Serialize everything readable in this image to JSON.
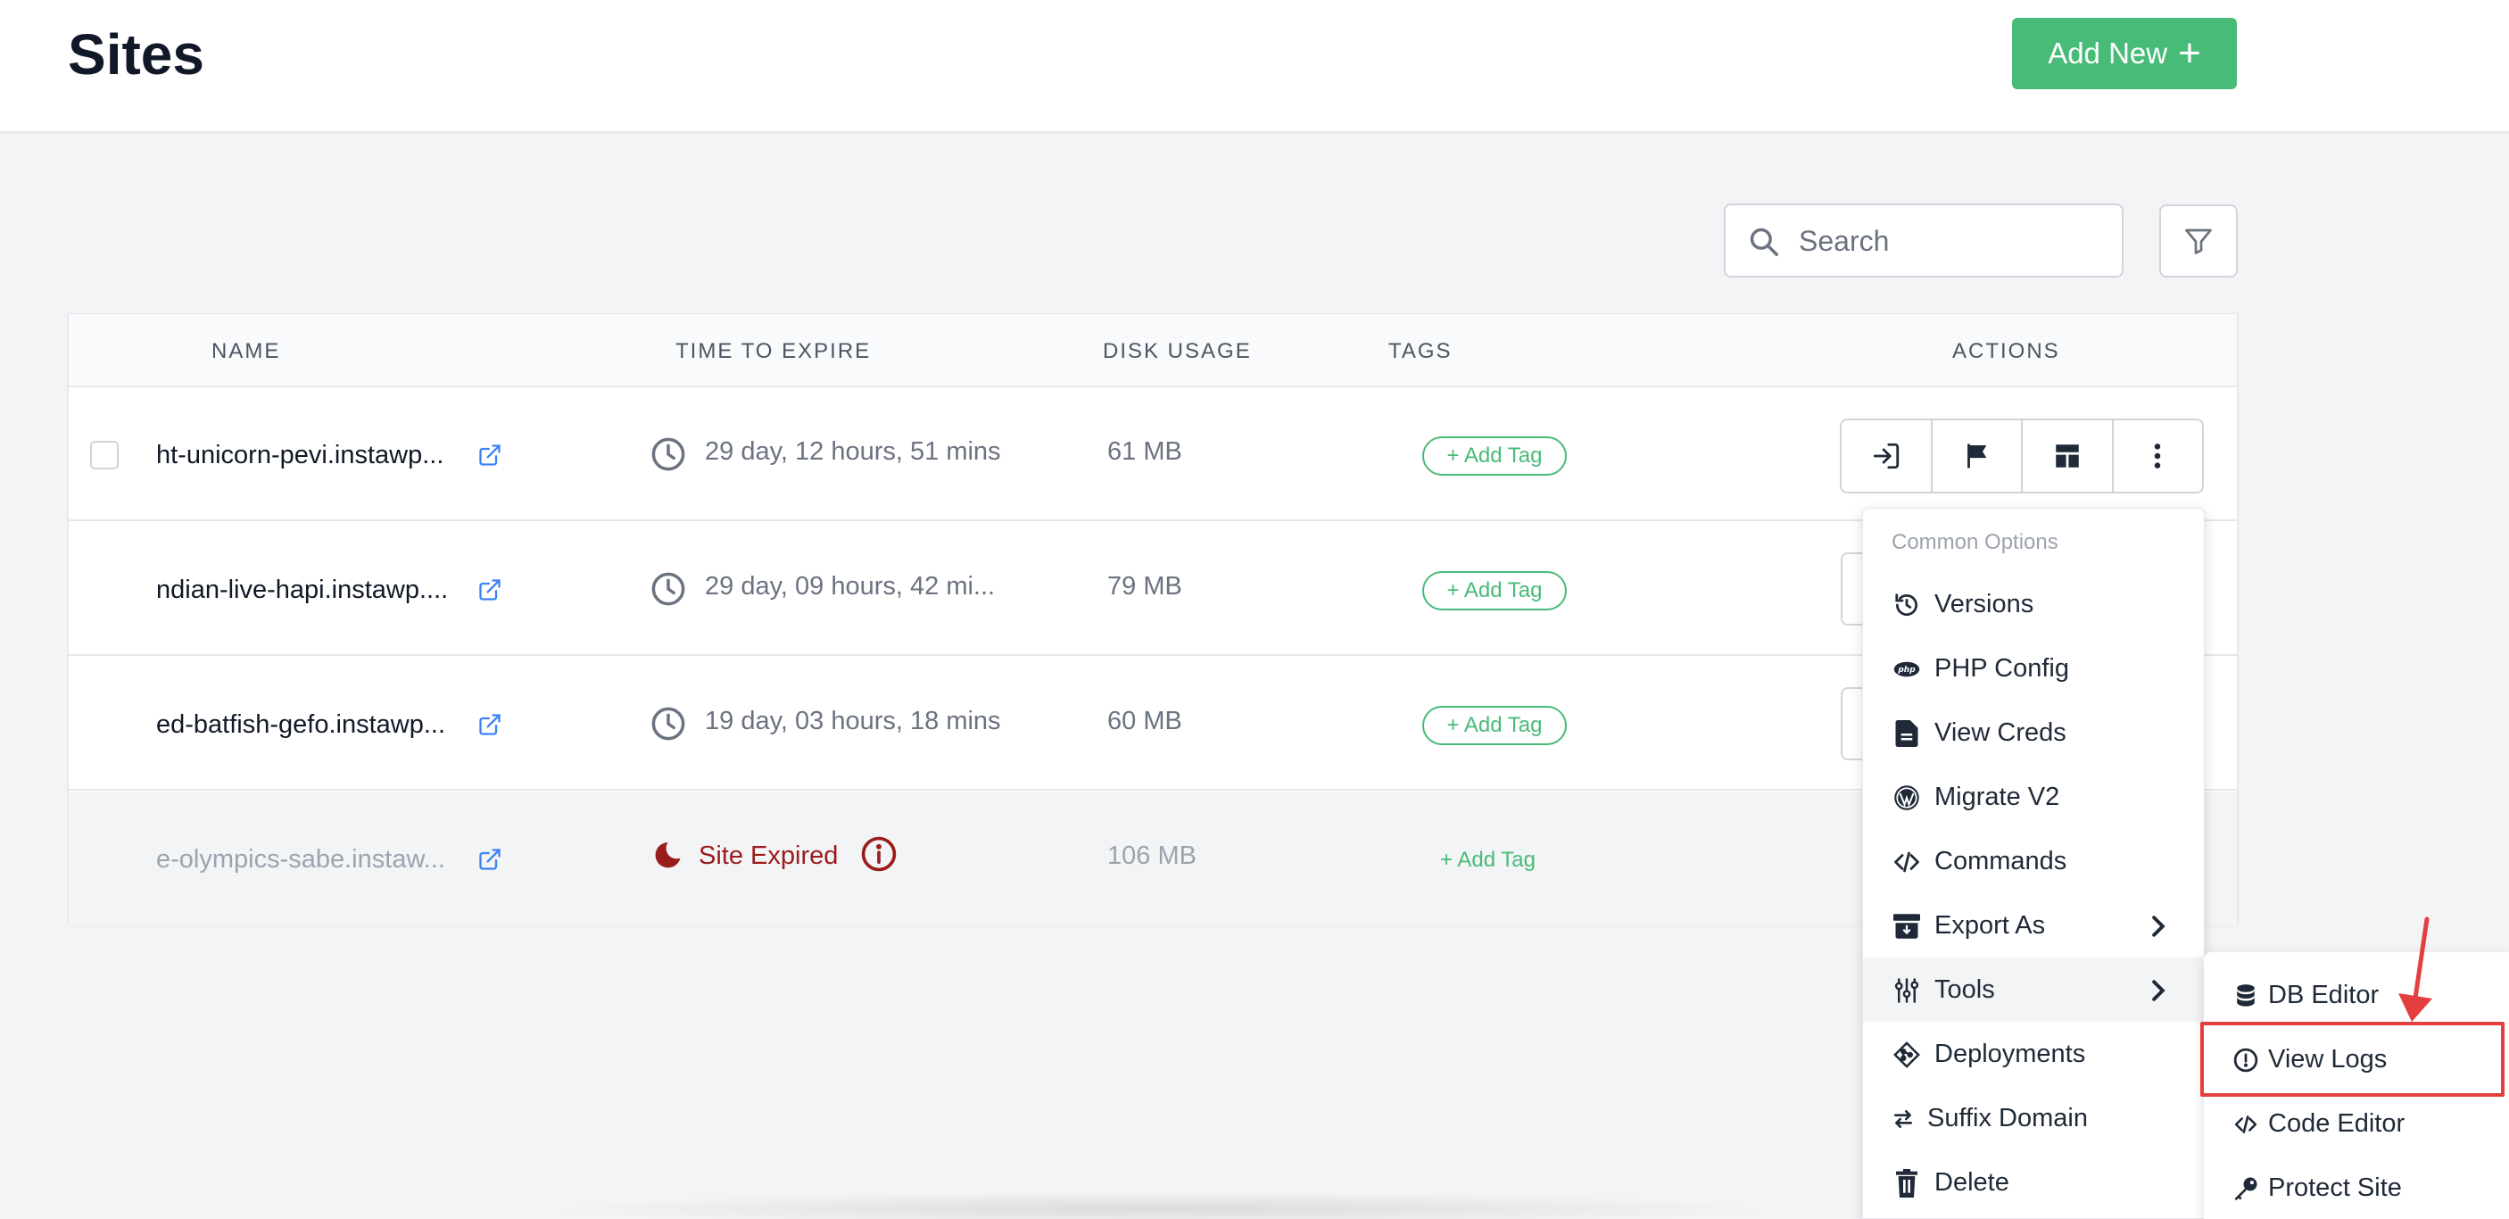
{
  "header": {
    "title": "Sites",
    "add_new_label": "Add New"
  },
  "search": {
    "placeholder": "Search"
  },
  "table": {
    "columns": {
      "name": "NAME",
      "time_to_expire": "TIME TO EXPIRE",
      "disk_usage": "DISK USAGE",
      "tags": "TAGS",
      "actions": "ACTIONS"
    },
    "rows": [
      {
        "name": "ht-unicorn-pevi.instawp...",
        "expire": "29 day, 12 hours, 51 mins",
        "disk": "61 MB",
        "tag_label": "+ Add Tag"
      },
      {
        "name": "ndian-live-hapi.instawp....",
        "expire": "29 day, 09 hours, 42 mi...",
        "disk": "79 MB",
        "tag_label": "+ Add Tag"
      },
      {
        "name": "ed-batfish-gefo.instawp...",
        "expire": "19 day, 03 hours, 18 mins",
        "disk": "60 MB",
        "tag_label": "+ Add Tag"
      },
      {
        "name": "e-olympics-sabe.instaw...",
        "expire": "Site Expired",
        "disk": "106 MB",
        "tag_label": "+ Add Tag"
      }
    ]
  },
  "actions": {
    "icons": [
      "login-icon",
      "flag-icon",
      "layout-icon",
      "more-vertical-icon"
    ]
  },
  "dropdown": {
    "header": "Common Options",
    "items": [
      {
        "label": "Versions",
        "icon": "history-icon"
      },
      {
        "label": "PHP Config",
        "icon": "php-icon"
      },
      {
        "label": "View Creds",
        "icon": "document-icon"
      },
      {
        "label": "Migrate V2",
        "icon": "wordpress-icon"
      },
      {
        "label": "Commands",
        "icon": "code-icon"
      },
      {
        "label": "Export As",
        "icon": "archive-icon"
      },
      {
        "label": "Tools",
        "icon": "sliders-icon"
      },
      {
        "label": "Deployments",
        "icon": "git-icon"
      },
      {
        "label": "Suffix Domain",
        "icon": "swap-icon"
      },
      {
        "label": "Delete",
        "icon": "trash-icon"
      }
    ]
  },
  "submenu": {
    "items": [
      {
        "label": "DB Editor",
        "icon": "database-icon"
      },
      {
        "label": "View Logs",
        "icon": "alert-circle-icon"
      },
      {
        "label": "Code Editor",
        "icon": "code-icon"
      },
      {
        "label": "Protect Site",
        "icon": "key-icon"
      }
    ]
  },
  "colors": {
    "accent_green": "#48bb78",
    "expired_red": "#9b1c1c",
    "highlight_red": "#e53e3e",
    "link_blue": "#3b82f6"
  }
}
